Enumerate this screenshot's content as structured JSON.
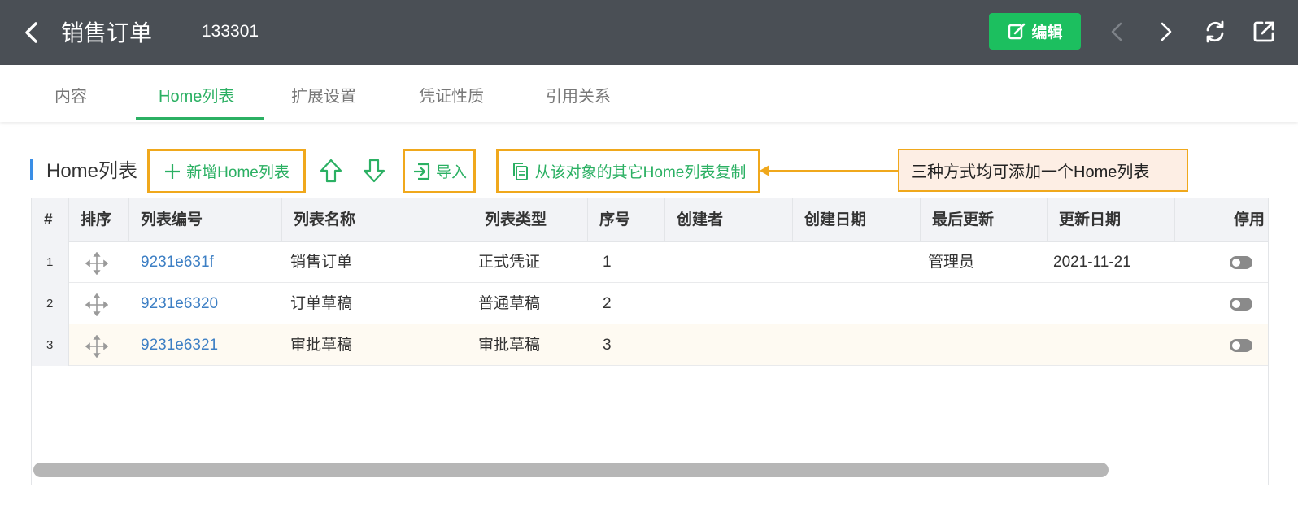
{
  "header": {
    "title": "销售订单",
    "doc_number": "133301",
    "edit_label": "编辑",
    "icons": [
      "chevron-left-icon",
      "edit-icon",
      "chevron-left-icon",
      "chevron-right-icon",
      "refresh-icon",
      "share-icon"
    ]
  },
  "tabs": [
    {
      "label": "内容",
      "active": false
    },
    {
      "label": "Home列表",
      "active": true
    },
    {
      "label": "扩展设置",
      "active": false
    },
    {
      "label": "凭证性质",
      "active": false
    },
    {
      "label": "引用关系",
      "active": false
    }
  ],
  "section": {
    "title": "Home列表",
    "add_label": "新增Home列表",
    "import_label": "导入",
    "copy_label": "从该对象的其它Home列表复制",
    "callout": "三种方式均可添加一个Home列表"
  },
  "table": {
    "columns": [
      "#",
      "排序",
      "列表编号",
      "列表名称",
      "列表类型",
      "序号",
      "创建者",
      "创建日期",
      "最后更新",
      "更新日期",
      "停用"
    ],
    "rows": [
      {
        "idx": "1",
        "code": "9231e631f",
        "name": "销售订单",
        "type": "正式凭证",
        "seq": "1",
        "creator": "",
        "created": "",
        "updater": "管理员",
        "updated": "2021-11-21",
        "disabled": false
      },
      {
        "idx": "2",
        "code": "9231e6320",
        "name": "订单草稿",
        "type": "普通草稿",
        "seq": "2",
        "creator": "",
        "created": "",
        "updater": "",
        "updated": "",
        "disabled": false
      },
      {
        "idx": "3",
        "code": "9231e6321",
        "name": "审批草稿",
        "type": "审批草稿",
        "seq": "3",
        "creator": "",
        "created": "",
        "updater": "",
        "updated": "",
        "disabled": false
      }
    ]
  },
  "colors": {
    "header_bg": "#4a4f55",
    "accent_green": "#2bb063",
    "edit_button": "#1cbf5f",
    "highlight_orange": "#f0a81c",
    "link_blue": "#3d7fc4",
    "section_marker": "#3a8ee6"
  }
}
